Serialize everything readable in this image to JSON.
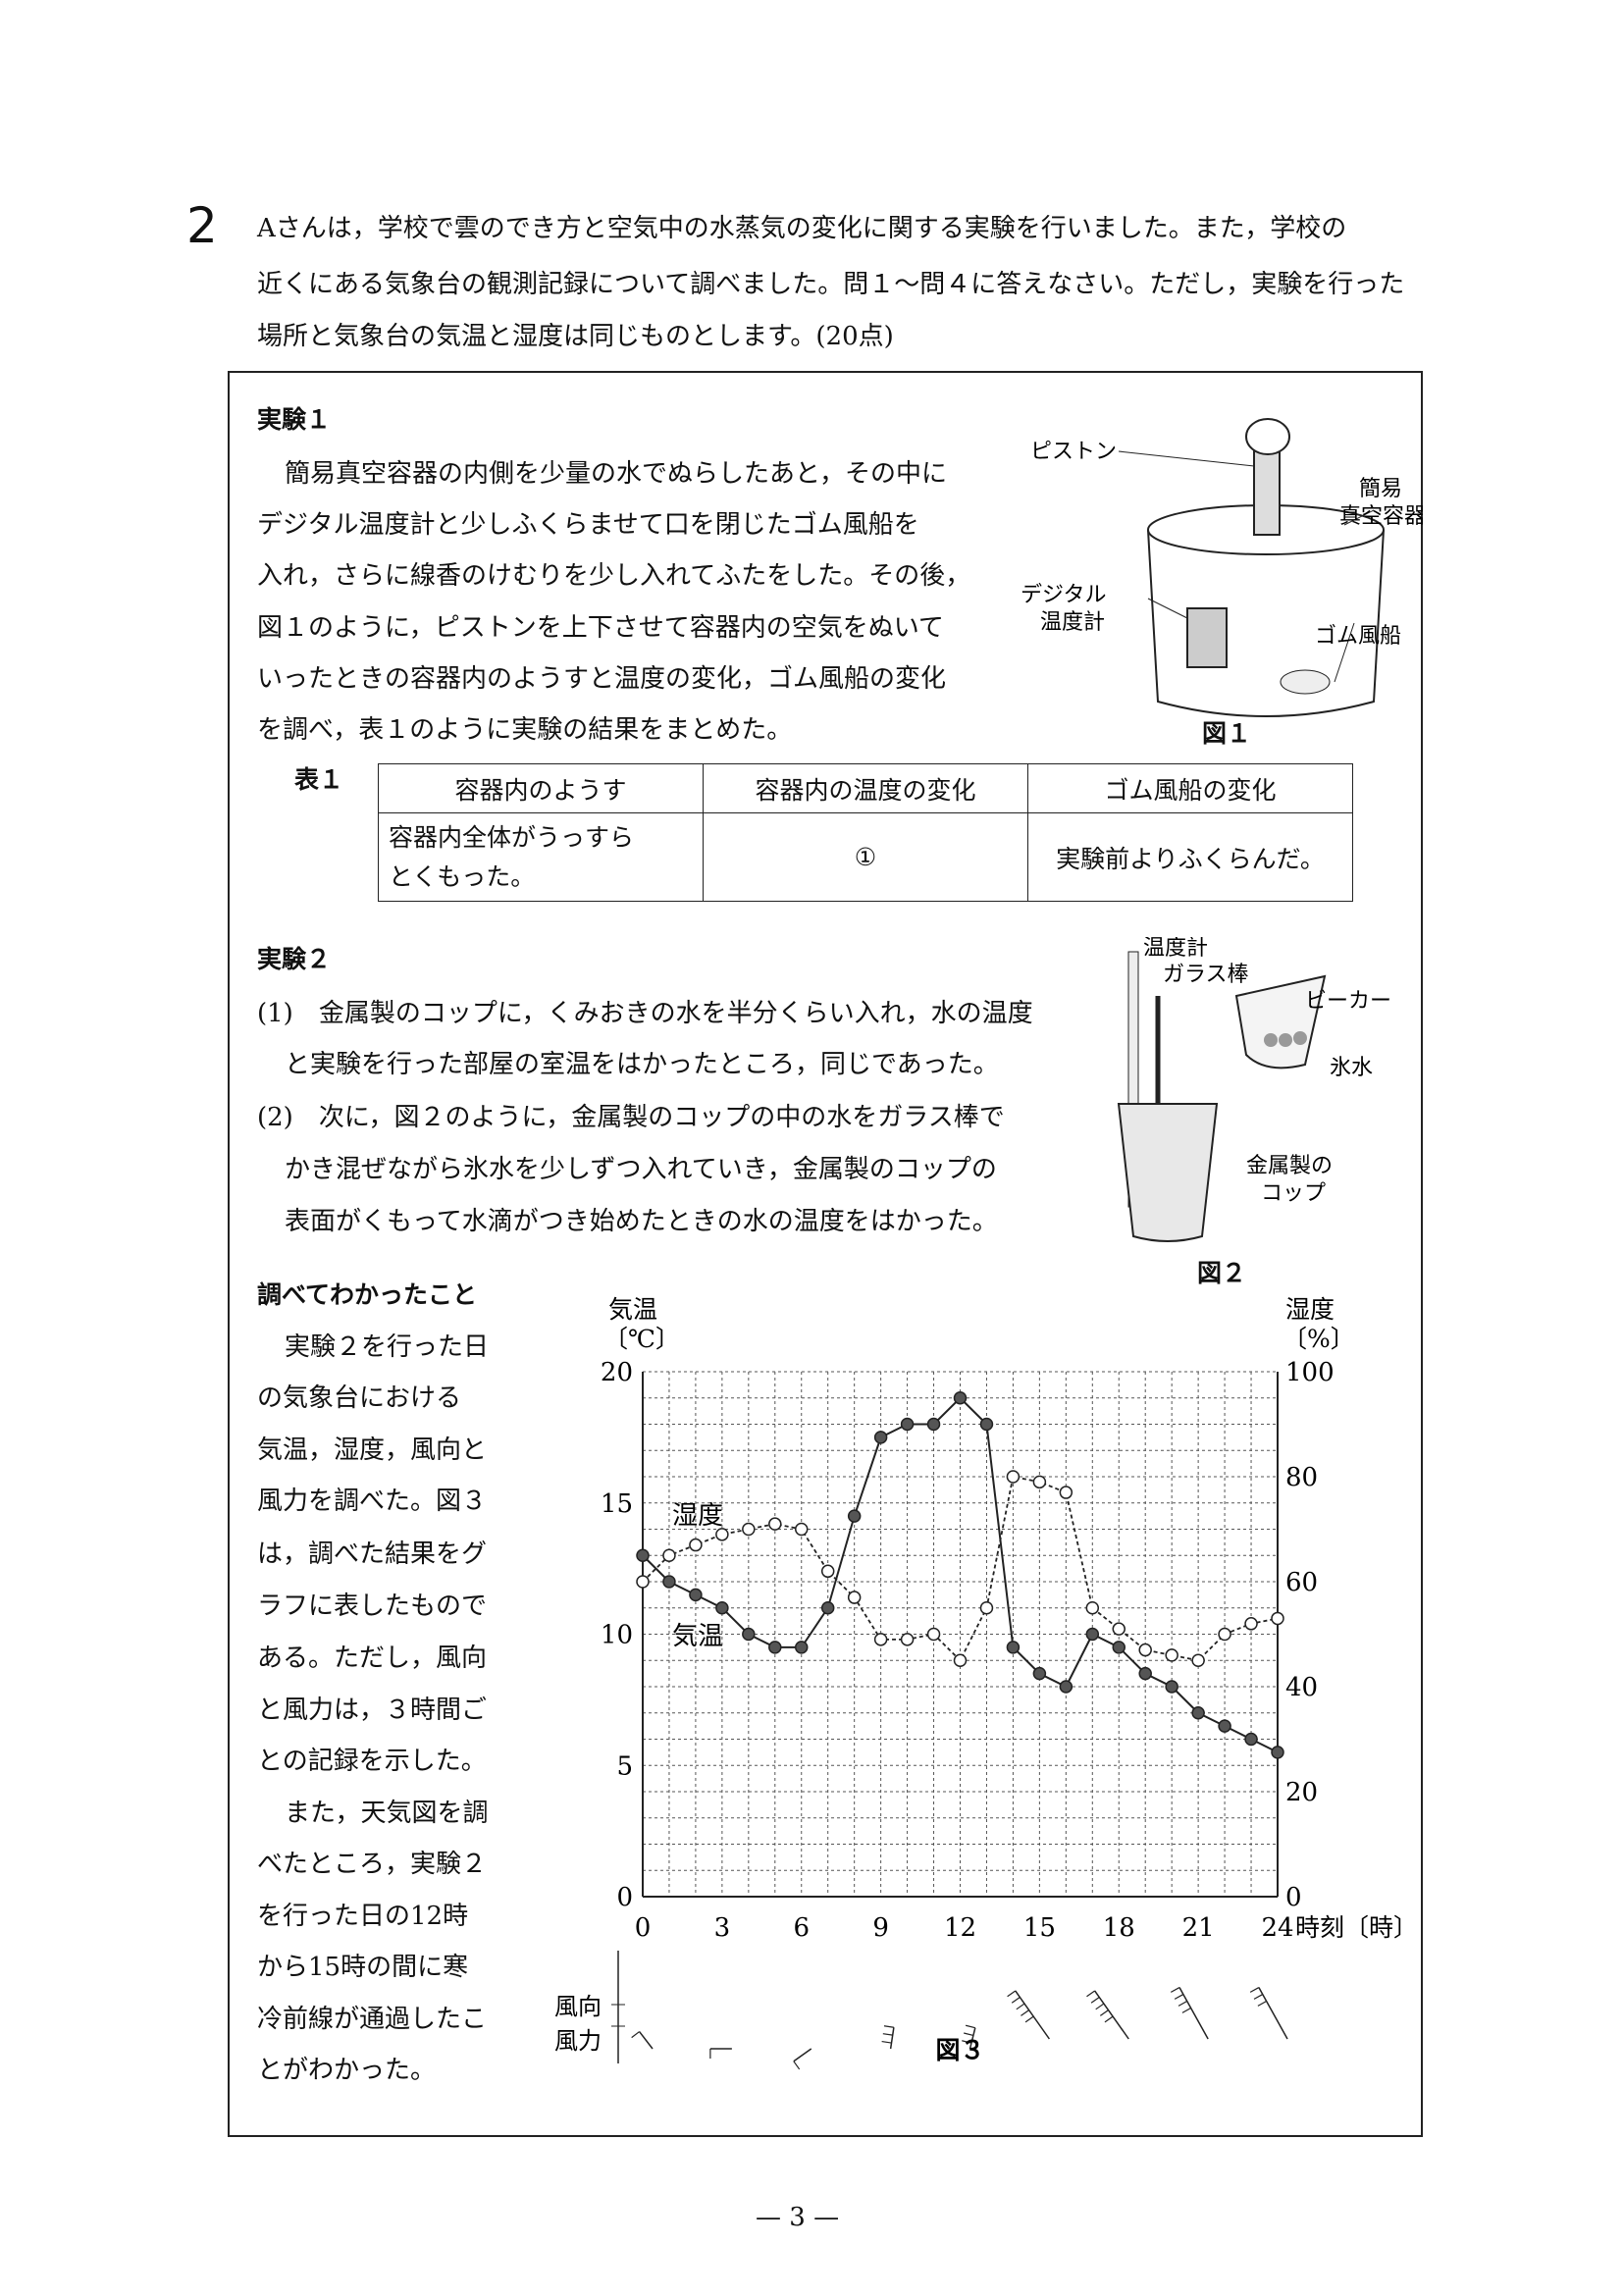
{
  "question_number": "2",
  "intro": [
    "Aさんは，学校で雲のでき方と空気中の水蒸気の変化に関する実験を行いました。また，学校の",
    "近くにある気象台の観測記録について調べました。問１～問４に答えなさい。ただし，実験を行った",
    "場所と気象台の気温と湿度は同じものとします。(20点)"
  ],
  "exp1": {
    "title": "実験１",
    "lines": [
      "簡易真空容器の内側を少量の水でぬらしたあと，その中に",
      "デジタル温度計と少しふくらませて口を閉じたゴム風船を",
      "入れ，さらに線香のけむりを少し入れてふたをした。その後，",
      "図１のように，ピストンを上下させて容器内の空気をぬいて",
      "いったときの容器内のようすと温度の変化，ゴム風船の変化",
      "を調べ，表１のように実験の結果をまとめた。"
    ],
    "figure": {
      "caption": "図１",
      "labels": [
        "ピストン",
        "簡易",
        "真空容器",
        "デジタル",
        "温度計",
        "ゴム風船"
      ]
    }
  },
  "table1": {
    "label": "表１",
    "headers": [
      "容器内のようす",
      "容器内の温度の変化",
      "ゴム風船の変化"
    ],
    "row": [
      "容器内全体がうっすら",
      "とくもった。",
      "①",
      "実験前よりふくらんだ。"
    ]
  },
  "exp2": {
    "title": "実験２",
    "lines": [
      "(1)　金属製のコップに，くみおきの水を半分くらい入れ，水の温度",
      "と実験を行った部屋の室温をはかったところ，同じであった。",
      "(2)　次に，図２のように，金属製のコップの中の水をガラス棒で",
      "かき混ぜながら氷水を少しずつ入れていき，金属製のコップの",
      "表面がくもって水滴がつき始めたときの水の温度をはかった。"
    ],
    "figure": {
      "caption": "図２",
      "labels": [
        "温度計",
        "ガラス棒",
        "ビーカー",
        "氷水",
        "金属製の",
        "コップ"
      ]
    }
  },
  "findings": {
    "title": "調べてわかったこと",
    "lines": [
      "実験２を行った日",
      "の気象台における",
      "気温，湿度，風向と",
      "風力を調べた。図３",
      "は，調べた結果をグ",
      "ラフに表したもので",
      "ある。ただし，風向",
      "と風力は，３時間ご",
      "との記録を示した。",
      "また，天気図を調",
      "べたところ，実験２",
      "を行った日の12時",
      "から15時の間に寒",
      "冷前線が通過したこ",
      "とがわかった。"
    ]
  },
  "chart_data": {
    "type": "line",
    "caption": "図３",
    "xlabel": "時刻〔時〕",
    "ylabel_left": [
      "気温",
      "〔℃〕"
    ],
    "ylabel_right": [
      "湿度",
      "〔%〕"
    ],
    "x": [
      0,
      1,
      2,
      3,
      4,
      5,
      6,
      7,
      8,
      9,
      10,
      11,
      12,
      13,
      14,
      15,
      16,
      17,
      18,
      19,
      20,
      21,
      22,
      23,
      24
    ],
    "xlim": [
      0,
      24
    ],
    "xticks": [
      "0",
      "3",
      "6",
      "9",
      "12",
      "15",
      "18",
      "21",
      "24"
    ],
    "ylim_left": [
      0,
      20
    ],
    "yticks_left": [
      "0",
      "5",
      "10",
      "15",
      "20"
    ],
    "ylim_right": [
      0,
      100
    ],
    "yticks_right": [
      "0",
      "20",
      "40",
      "60",
      "80",
      "100"
    ],
    "grid": true,
    "series": [
      {
        "name": "気温",
        "axis": "left",
        "style": "solid-filled",
        "values": [
          13,
          12,
          11.5,
          11,
          10,
          9.5,
          9.5,
          11,
          14.5,
          17.5,
          18,
          18,
          19,
          18,
          9.5,
          8.5,
          8,
          10,
          9.5,
          8.5,
          8,
          7,
          6.5,
          6,
          5.5
        ]
      },
      {
        "name": "湿度",
        "axis": "right",
        "style": "dotted-open",
        "values": [
          60,
          65,
          67,
          69,
          70,
          71,
          70,
          62,
          57,
          49,
          49,
          50,
          45,
          55,
          80,
          79,
          77,
          55,
          51,
          47,
          46,
          45,
          50,
          52,
          53
        ]
      }
    ],
    "wind": {
      "label": [
        "風向",
        "風力"
      ],
      "hours": [
        0,
        3,
        6,
        9,
        12,
        15,
        18,
        21,
        24
      ],
      "force": [
        1,
        1,
        1,
        3,
        3,
        5,
        5,
        4,
        3
      ]
    }
  },
  "page_number": "— 3 —"
}
